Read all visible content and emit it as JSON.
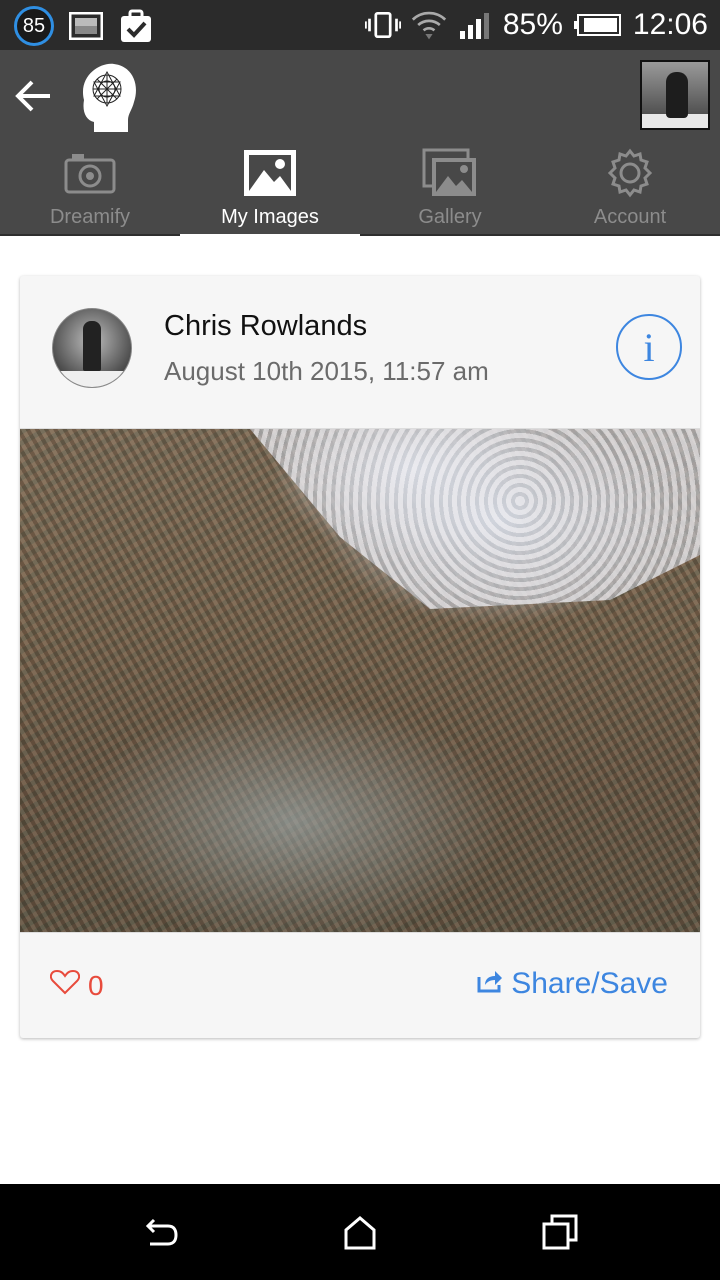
{
  "status_bar": {
    "notification_count": "85",
    "battery": "85%",
    "time": "12:06",
    "icons": [
      "image-notification-icon",
      "clipboard-check-icon",
      "vibrate-icon",
      "wifi-icon",
      "signal-icon",
      "battery-icon"
    ]
  },
  "header": {
    "back_icon": "arrow-left-icon",
    "logo_icon": "dreamify-head-logo"
  },
  "tabs": [
    {
      "label": "Dreamify",
      "icon": "camera-icon",
      "active": false
    },
    {
      "label": "My Images",
      "icon": "image-icon",
      "active": true
    },
    {
      "label": "Gallery",
      "icon": "gallery-icon",
      "active": false
    },
    {
      "label": "Account",
      "icon": "gear-icon",
      "active": false
    }
  ],
  "post": {
    "author": "Chris Rowlands",
    "date": "August 10th 2015, 11:57 am",
    "info_glyph": "i",
    "likes": "0",
    "share_label": "Share/Save"
  },
  "colors": {
    "accent": "#3d86e0",
    "like": "#e84b3c",
    "header_bg": "#484848",
    "status_bg": "#2b2b2b"
  }
}
